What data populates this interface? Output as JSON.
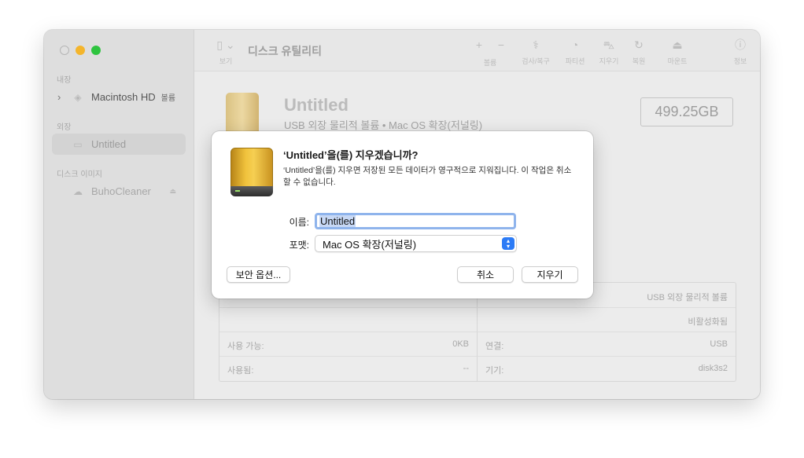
{
  "window": {
    "toolbar": {
      "view_label": "보기",
      "title": "디스크 유틸리티",
      "buttons": [
        {
          "glyph": "+",
          "label": "볼륨"
        },
        {
          "glyph": "−",
          "label": ""
        },
        {
          "glyph": "⚕",
          "label": "검사/복구"
        },
        {
          "glyph": "◔",
          "label": "파티션"
        },
        {
          "glyph": "⛍",
          "label": "지우기"
        },
        {
          "glyph": "↻",
          "label": "복원"
        },
        {
          "glyph": "⏏",
          "label": "마운트"
        },
        {
          "glyph": "ⓘ",
          "label": "정보"
        }
      ]
    },
    "sidebar": {
      "section_internal": "내장",
      "item_macintosh": "Macintosh HD",
      "item_macintosh_tag": "볼륨",
      "section_external": "외장",
      "item_untitled": "Untitled",
      "section_images": "디스크 이미지",
      "item_buho": "BuhoCleaner"
    },
    "content": {
      "disk_name": "Untitled",
      "disk_subtitle": "USB 외장 물리적 볼륨 • Mac OS 확장(저널링)",
      "disk_size": "499.25GB",
      "info": {
        "row1_right_value": "USB 외장 물리적 볼륨",
        "row2_right_value": "비활성화됨",
        "available_label": "사용 가능:",
        "available_value": "0KB",
        "connection_label": "연결:",
        "connection_value": "USB",
        "used_label": "사용됨:",
        "used_value": "--",
        "device_label": "기기:",
        "device_value": "disk3s2"
      }
    }
  },
  "dialog": {
    "title": "‘Untitled’을(를) 지우겠습니까?",
    "message": "‘Untitled’을(를) 지우면 저장된 모든 데이터가 영구적으로 지워집니다. 이 작업은 취소할 수 없습니다.",
    "name_label": "이름:",
    "name_value": "Untitled",
    "format_label": "포맷:",
    "format_value": "Mac OS 확장(저널링)",
    "security_button": "보안 옵션...",
    "cancel_button": "취소",
    "erase_button": "지우기"
  }
}
